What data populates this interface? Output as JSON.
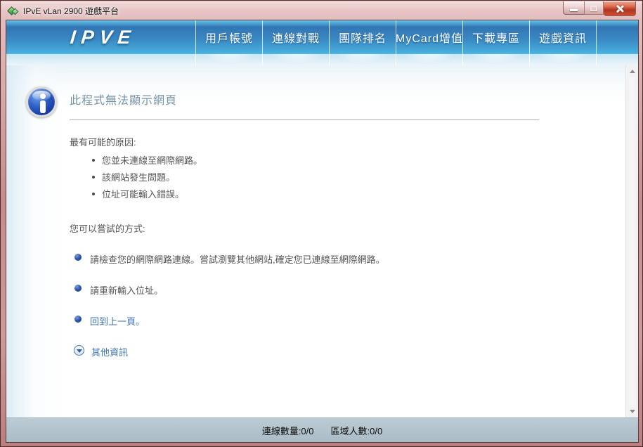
{
  "window": {
    "title": "IPvE vLan 2900 遊戲平台"
  },
  "nav": {
    "logo": "IPVE",
    "items": [
      {
        "label": "用戶帳號"
      },
      {
        "label": "連線對戰"
      },
      {
        "label": "團隊排名"
      },
      {
        "label": "MyCard增值"
      },
      {
        "label": "下載專區"
      },
      {
        "label": "遊戲資訊"
      }
    ]
  },
  "error_page": {
    "heading": "此程式無法顯示網頁",
    "causes_heading": "最有可能的原因:",
    "causes": [
      "您並未連線至網際網路。",
      "該網站發生問題。",
      "位址可能輸入錯誤。"
    ],
    "try_heading": "您可以嘗試的方式:",
    "suggestion_check": "請檢查您的網際網路連線。嘗試瀏覽其他網站,確定您已連線至網際網路。",
    "suggestion_retype": "請重新輸入位址。",
    "link_back": "回到上一頁。",
    "link_more": "其他資訊"
  },
  "status_bar": {
    "connections": "連線數量:0/0",
    "area_players": "區域人數:0/0"
  },
  "icons": {
    "app": "green-network-icon",
    "minimize": "minimize-bar-icon",
    "maximize": "maximize-box-icon",
    "close": "close-x-icon",
    "info": "info-circle-icon",
    "more_info": "chevron-down-circle-icon",
    "scroll_up": "triangle-up-icon",
    "scroll_down": "triangle-down-icon"
  },
  "colors": {
    "titlebar_rose": "#cf9a9a",
    "nav_blue_dark": "#3276b4",
    "nav_blue_light": "#47aedd",
    "heading_slate": "#7694a9",
    "link_blue": "#3a72b4",
    "status_gray_blue": "#aabcc6",
    "close_red": "#b23420"
  }
}
